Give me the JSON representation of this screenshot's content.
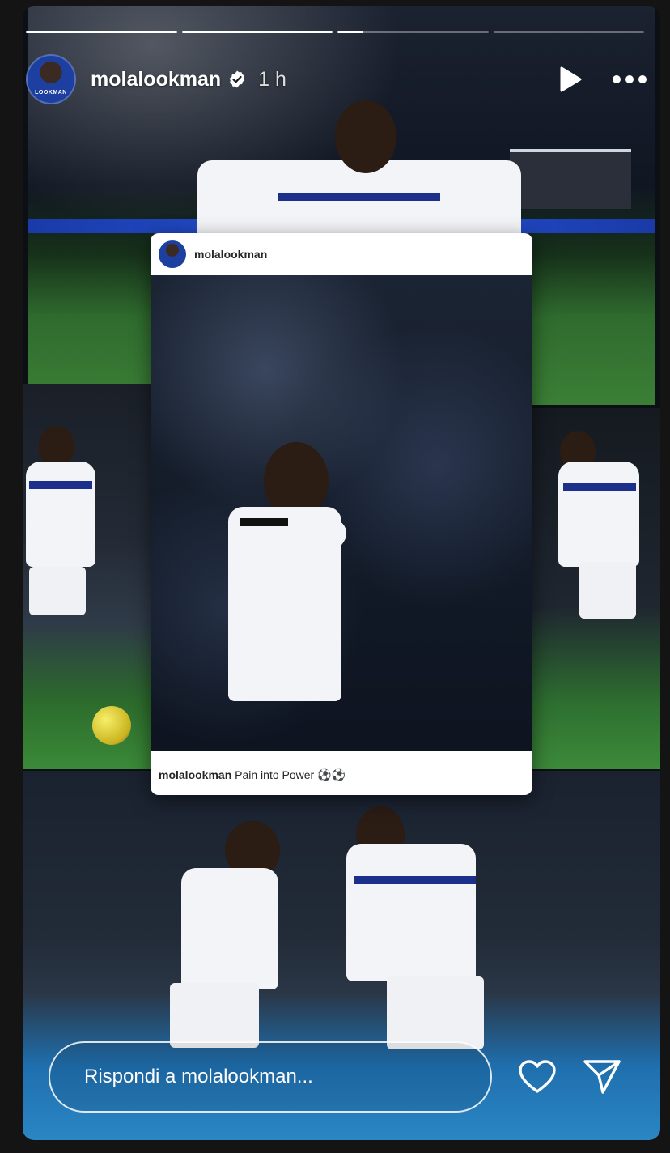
{
  "story": {
    "username": "molalookman",
    "time": "1 h",
    "avatar_label": "LOOKMAN",
    "progress": [
      1,
      1,
      0.17,
      0
    ],
    "icons": {
      "verified": "verified-badge-icon",
      "play": "play-icon",
      "more": "more-horizontal-icon"
    }
  },
  "post": {
    "username": "molalookman",
    "caption_user": "molalookman",
    "caption_text": "Pain into Power ⚽⚽"
  },
  "reply": {
    "placeholder": "Rispondi a molalookman...",
    "icons": {
      "like": "heart-icon",
      "send": "send-icon"
    }
  }
}
